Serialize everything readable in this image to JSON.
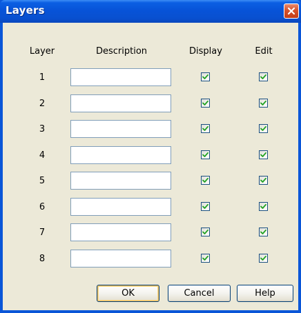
{
  "window": {
    "title": "Layers"
  },
  "headers": {
    "layer": "Layer",
    "description": "Description",
    "display": "Display",
    "edit": "Edit"
  },
  "rows": [
    {
      "number": "1",
      "description": "",
      "display": true,
      "edit": true
    },
    {
      "number": "2",
      "description": "",
      "display": true,
      "edit": true
    },
    {
      "number": "3",
      "description": "",
      "display": true,
      "edit": true
    },
    {
      "number": "4",
      "description": "",
      "display": true,
      "edit": true
    },
    {
      "number": "5",
      "description": "",
      "display": true,
      "edit": true
    },
    {
      "number": "6",
      "description": "",
      "display": true,
      "edit": true
    },
    {
      "number": "7",
      "description": "",
      "display": true,
      "edit": true
    },
    {
      "number": "8",
      "description": "",
      "display": true,
      "edit": true
    }
  ],
  "buttons": {
    "ok": "OK",
    "cancel": "Cancel",
    "help": "Help"
  },
  "colors": {
    "title_bar": "#0753d8",
    "close_button": "#d6512a",
    "dialog_face": "#ece9d8",
    "check_mark": "#21a121"
  },
  "icons": {
    "close": "close-icon",
    "check": "check-icon"
  }
}
